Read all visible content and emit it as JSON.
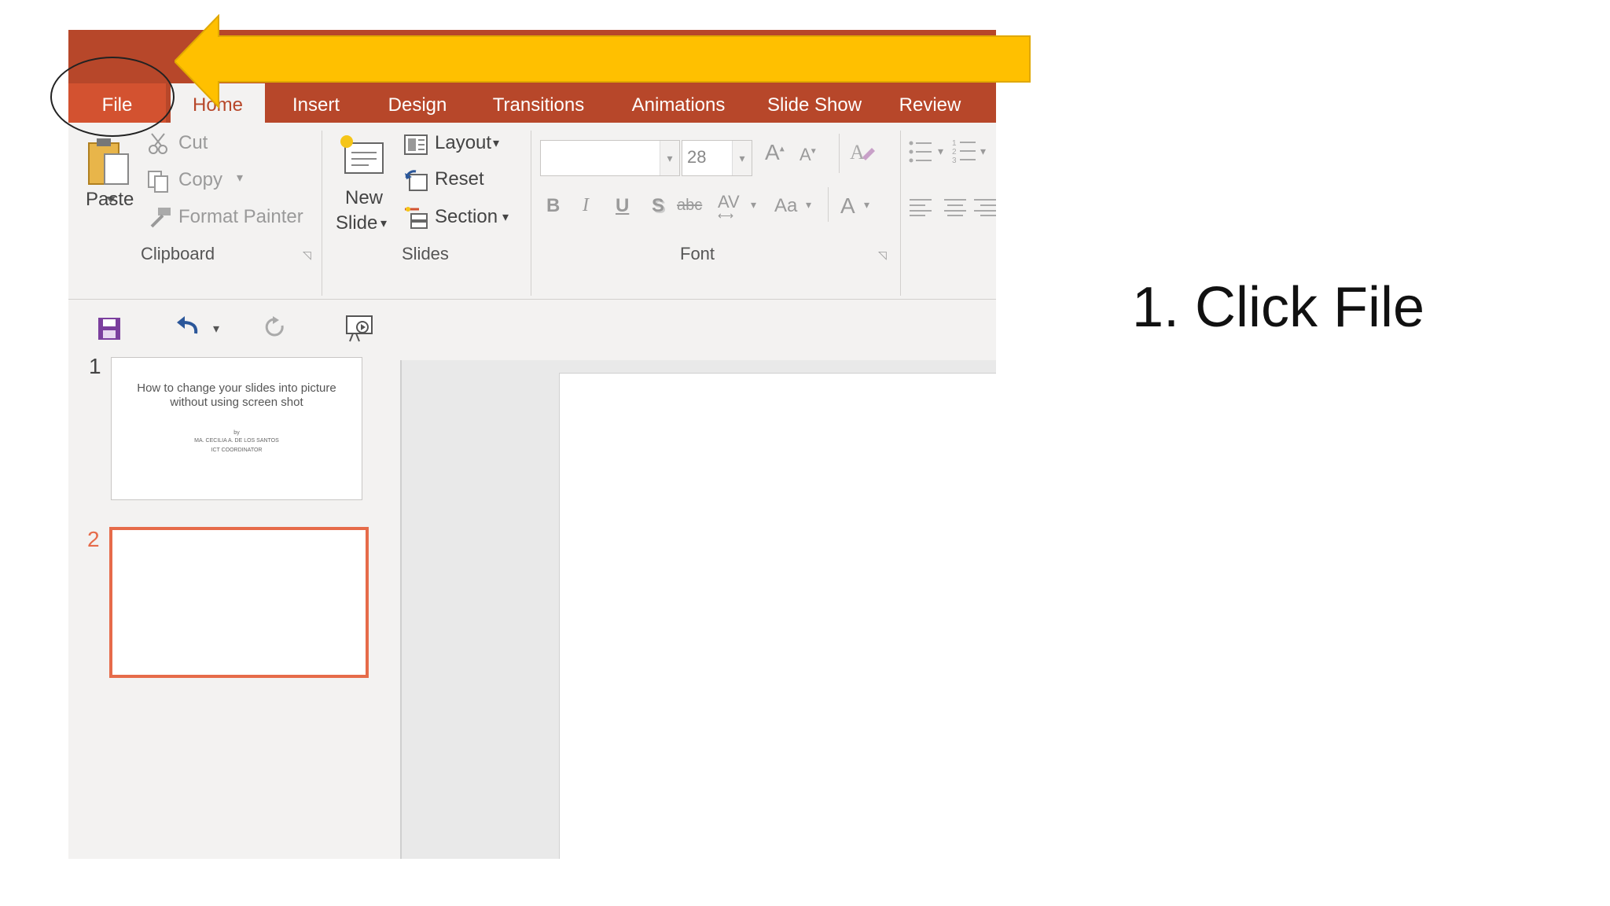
{
  "tabs": [
    "File",
    "Home",
    "Insert",
    "Design",
    "Transitions",
    "Animations",
    "Slide Show",
    "Review"
  ],
  "clipboard": {
    "paste": "Paste",
    "cut": "Cut",
    "copy": "Copy",
    "format_painter": "Format Painter",
    "group_label": "Clipboard"
  },
  "slides_group": {
    "new_slide_line1": "New",
    "new_slide_line2": "Slide",
    "layout": "Layout",
    "reset": "Reset",
    "section": "Section",
    "group_label": "Slides"
  },
  "font_group": {
    "font_name": "",
    "font_size": "28",
    "bold": "B",
    "italic": "I",
    "underline": "U",
    "shadow": "S",
    "strike": "abc",
    "spacing": "AV",
    "change_case": "Aa",
    "font_color": "A",
    "group_label": "Font"
  },
  "thumbnails": [
    {
      "number": "1",
      "title": "How to change your slides into picture without using screen shot",
      "by": "by",
      "author": "MA. CECILIA A. DE LOS SANTOS",
      "role": "ICT COORDINATOR"
    },
    {
      "number": "2"
    }
  ],
  "annotation": {
    "caption": "1. Click File"
  },
  "colors": {
    "accent": "#b7472a",
    "file_tab": "#d35230",
    "arrow": "#ffc000",
    "selected_thumb": "#e66b4a"
  }
}
